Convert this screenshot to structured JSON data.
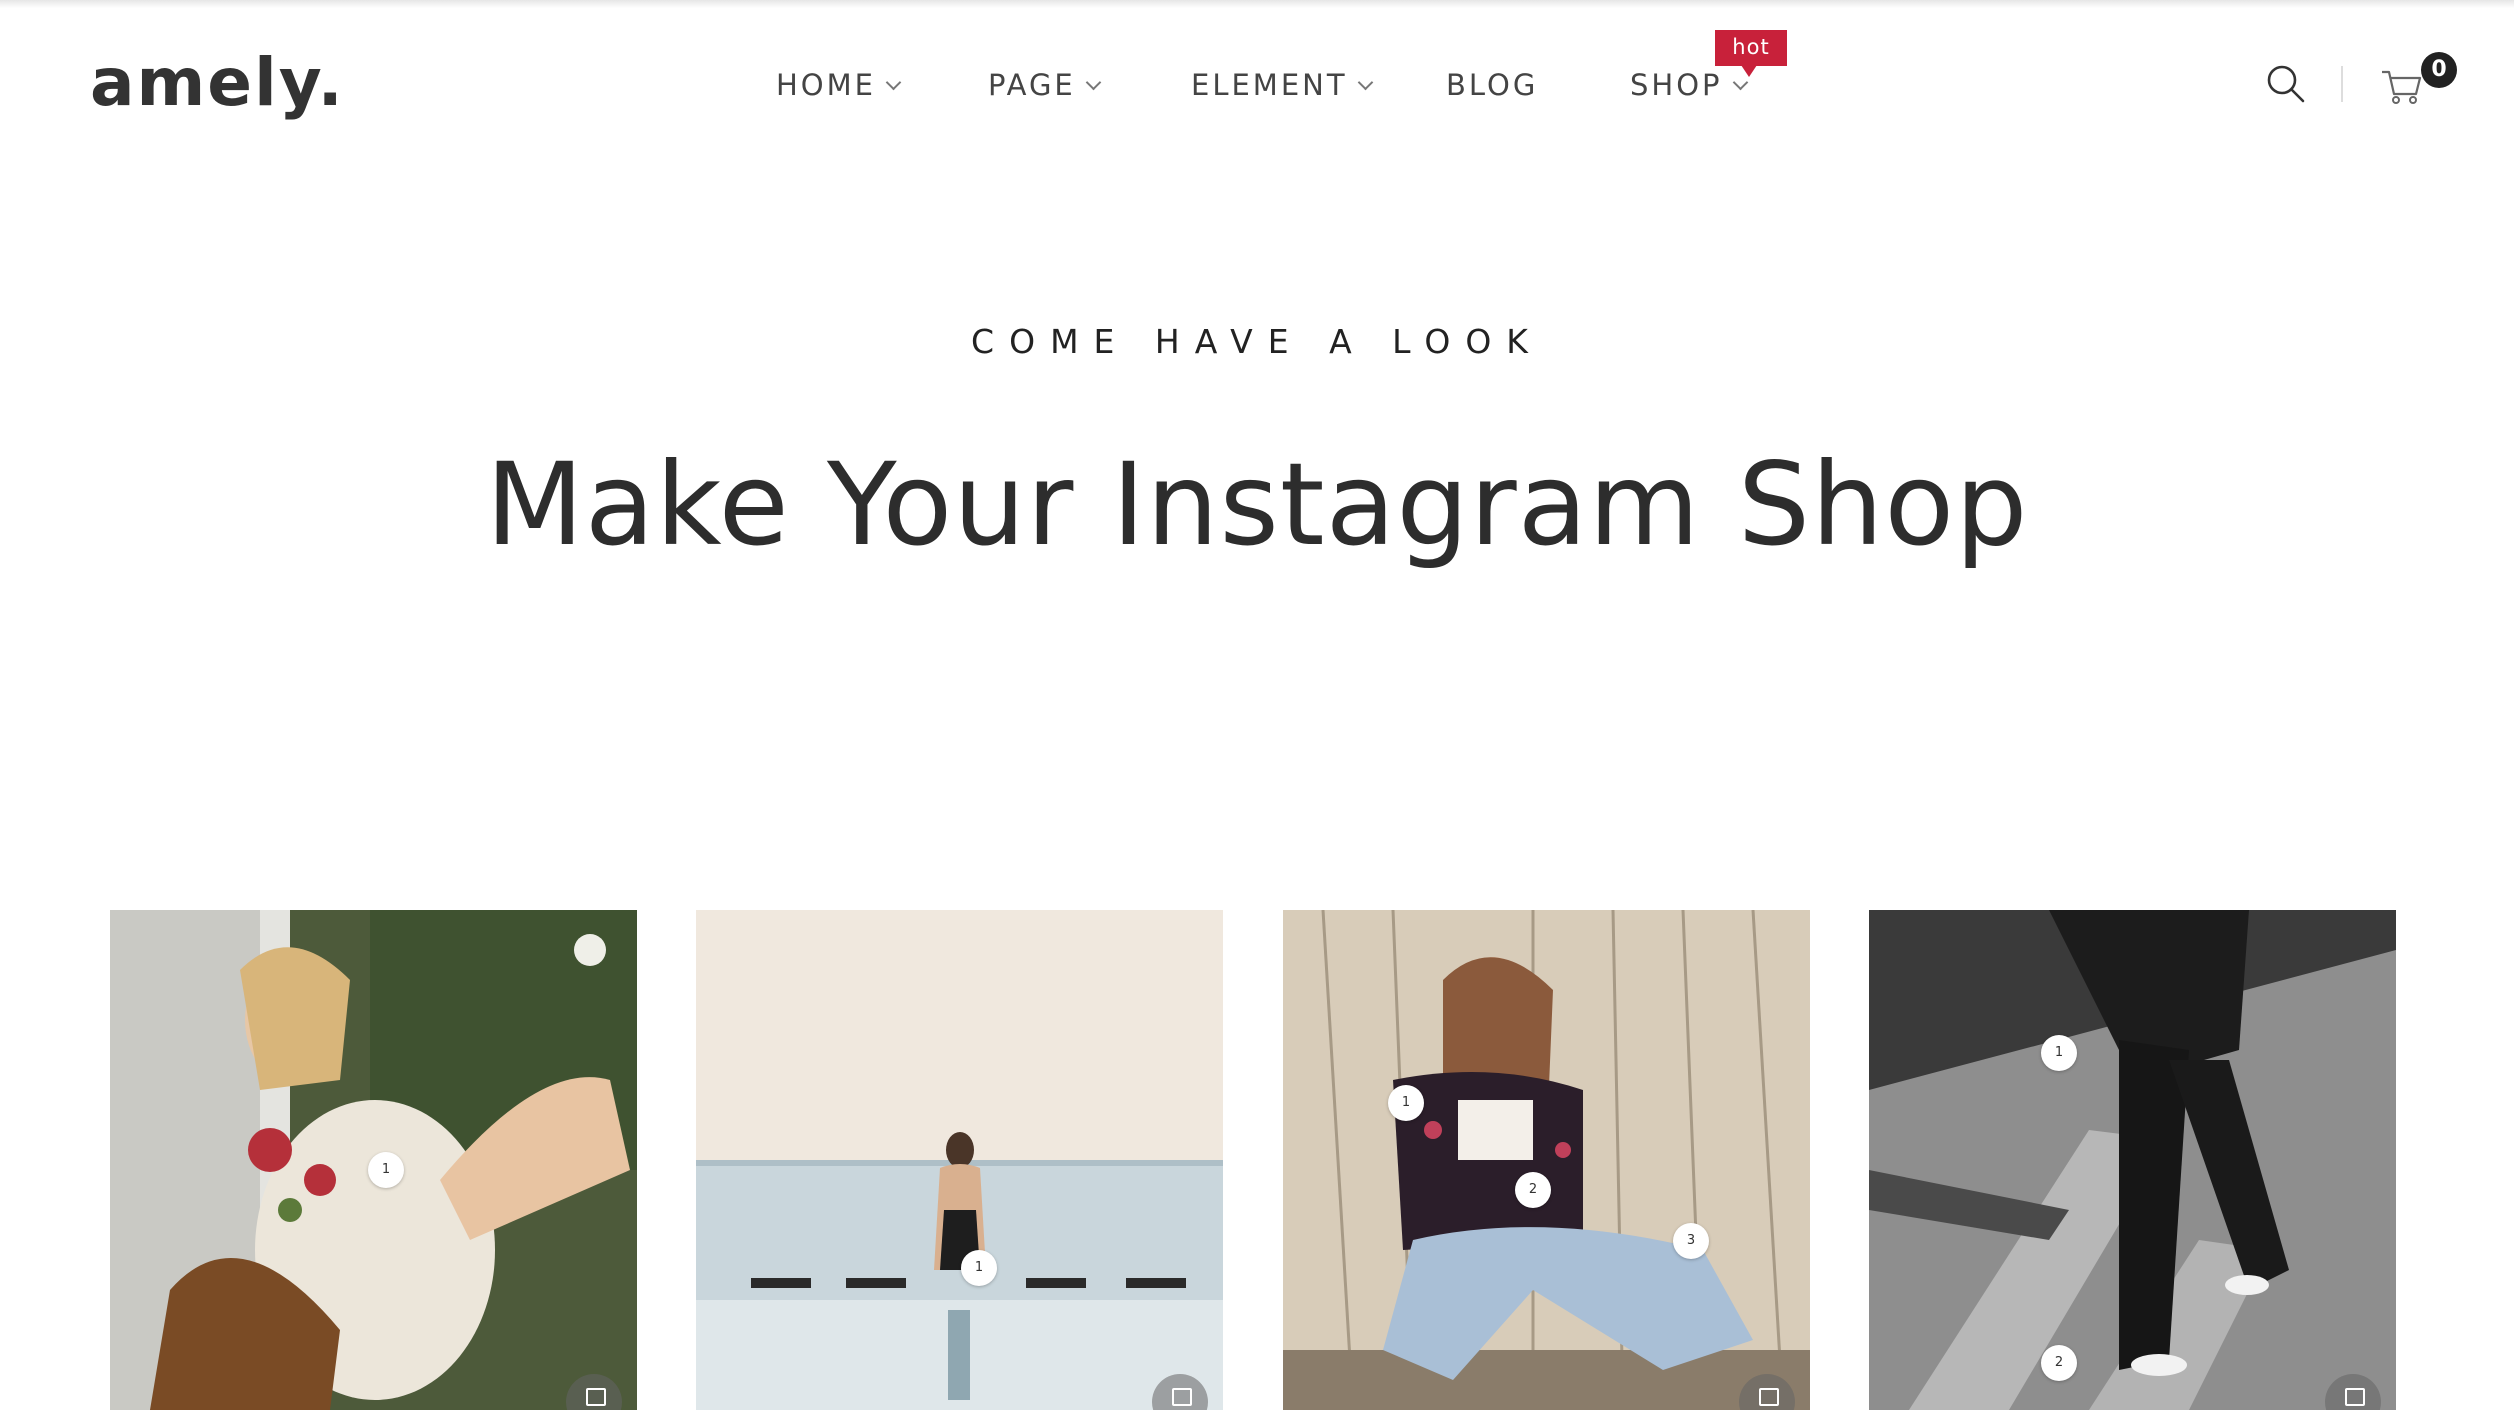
{
  "header": {
    "logo": "amely.",
    "nav": [
      {
        "label": "HOME",
        "has_dropdown": true
      },
      {
        "label": "PAGE",
        "has_dropdown": true
      },
      {
        "label": "ELEMENT",
        "has_dropdown": true
      },
      {
        "label": "BLOG",
        "has_dropdown": false
      },
      {
        "label": "SHOP",
        "has_dropdown": true,
        "badge": "hot"
      }
    ],
    "cart_count": "0",
    "badge_color": "#c8213a"
  },
  "hero": {
    "eyebrow": "COME HAVE A LOOK",
    "title": "Make Your Instagram Shop"
  },
  "gallery": [
    {
      "hotspots": [
        "1"
      ]
    },
    {
      "hotspots": [
        "1"
      ]
    },
    {
      "hotspots": [
        "1",
        "2",
        "3"
      ]
    },
    {
      "hotspots": [
        "1",
        "2"
      ]
    }
  ]
}
